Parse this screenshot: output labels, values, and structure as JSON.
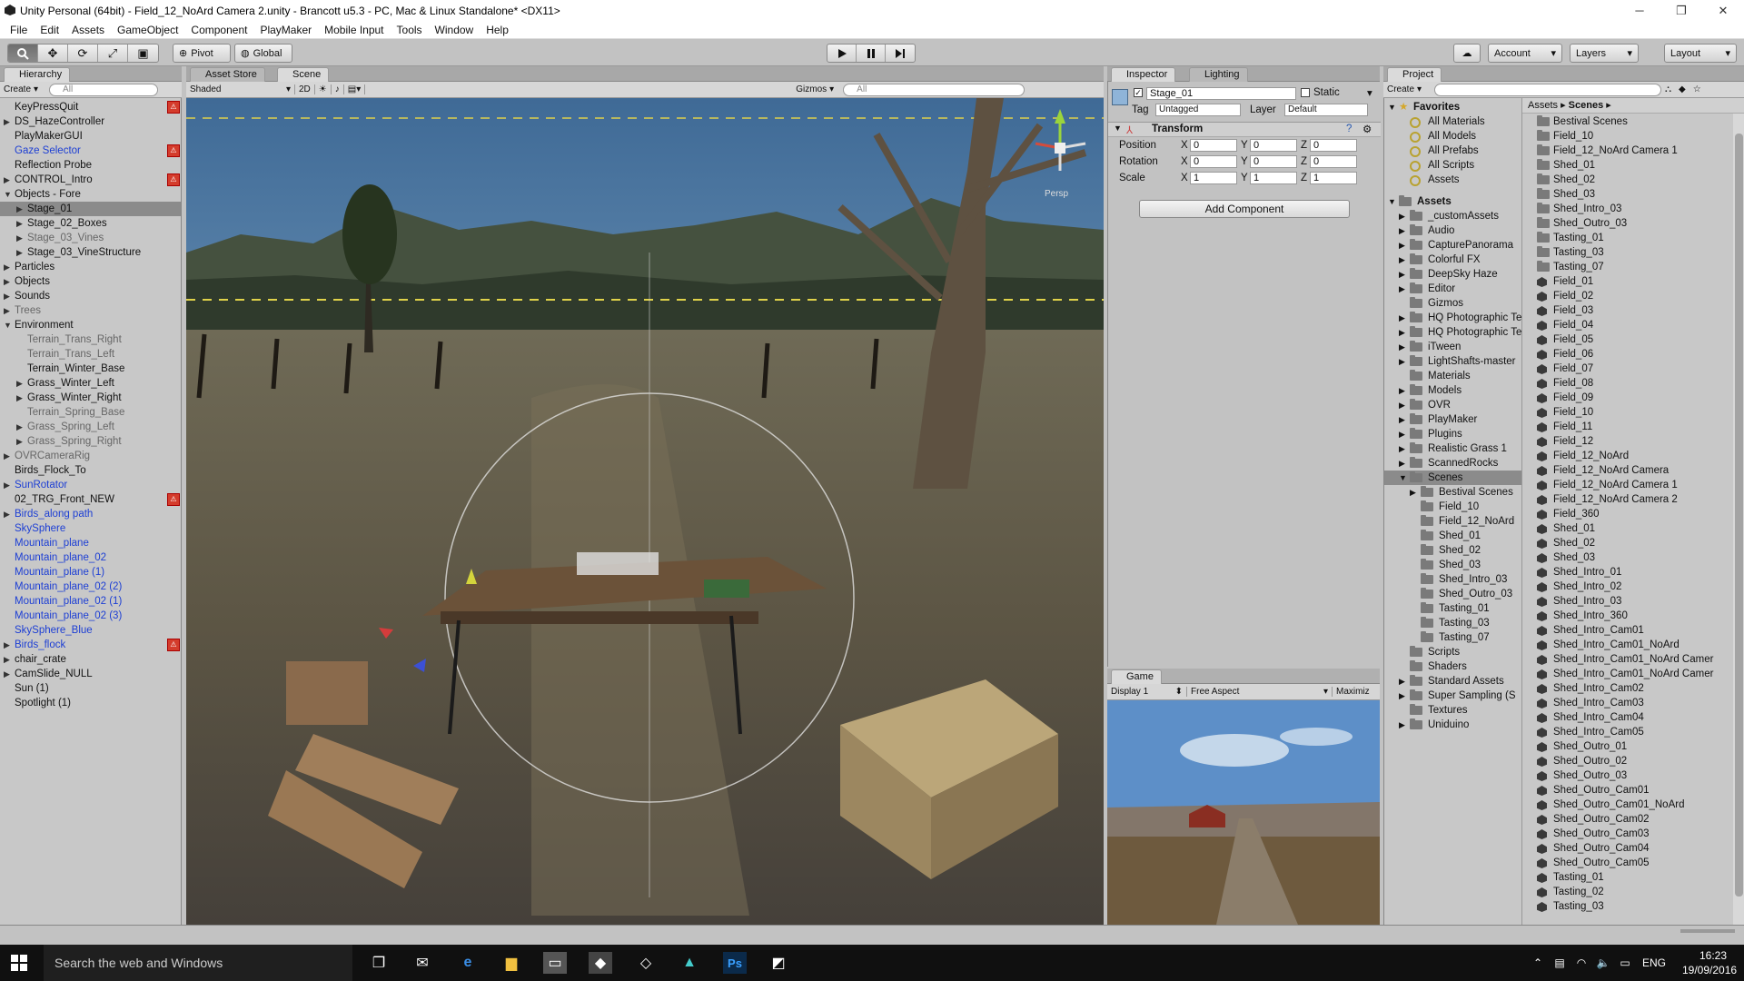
{
  "window": {
    "title": "Unity Personal (64bit) - Field_12_NoArd Camera 2.unity - Brancott u5.3 - PC, Mac & Linux Standalone* <DX11>",
    "controls": [
      "─",
      "❐",
      "✕"
    ]
  },
  "menus": [
    "File",
    "Edit",
    "Assets",
    "GameObject",
    "Component",
    "PlayMaker",
    "Mobile Input",
    "Tools",
    "Window",
    "Help"
  ],
  "toolbar": {
    "pivot": "Pivot",
    "global": "Global",
    "account": "Account",
    "layers": "Layers",
    "layout": "Layout"
  },
  "hierarchy": {
    "tab": "Hierarchy",
    "create": "Create",
    "search": "All",
    "items": [
      {
        "label": "KeyPressQuit",
        "indent": 0,
        "tri": "",
        "prefab": true,
        "color": "normal"
      },
      {
        "label": "DS_HazeController",
        "indent": 0,
        "tri": "▶",
        "prefab": false,
        "color": "normal"
      },
      {
        "label": "PlayMakerGUI",
        "indent": 0,
        "tri": "",
        "prefab": false,
        "color": "normal"
      },
      {
        "label": "Gaze Selector",
        "indent": 0,
        "tri": "",
        "prefab": true,
        "color": "blue"
      },
      {
        "label": "Reflection Probe",
        "indent": 0,
        "tri": "",
        "prefab": false,
        "color": "normal"
      },
      {
        "label": "CONTROL_Intro",
        "indent": 0,
        "tri": "▶",
        "prefab": true,
        "color": "normal"
      },
      {
        "label": "Objects - Fore",
        "indent": 0,
        "tri": "▼",
        "prefab": false,
        "color": "normal"
      },
      {
        "label": "Stage_01",
        "indent": 1,
        "tri": "▶",
        "prefab": false,
        "color": "sel"
      },
      {
        "label": "Stage_02_Boxes",
        "indent": 1,
        "tri": "▶",
        "prefab": false,
        "color": "normal"
      },
      {
        "label": "Stage_03_Vines",
        "indent": 1,
        "tri": "▶",
        "prefab": false,
        "color": "grey"
      },
      {
        "label": "Stage_03_VineStructure",
        "indent": 1,
        "tri": "▶",
        "prefab": false,
        "color": "normal"
      },
      {
        "label": "Particles",
        "indent": 0,
        "tri": "▶",
        "prefab": false,
        "color": "normal"
      },
      {
        "label": "Objects",
        "indent": 0,
        "tri": "▶",
        "prefab": false,
        "color": "normal"
      },
      {
        "label": "Sounds",
        "indent": 0,
        "tri": "▶",
        "prefab": false,
        "color": "normal"
      },
      {
        "label": "Trees",
        "indent": 0,
        "tri": "▶",
        "prefab": false,
        "color": "grey"
      },
      {
        "label": "Environment",
        "indent": 0,
        "tri": "▼",
        "prefab": false,
        "color": "normal"
      },
      {
        "label": "Terrain_Trans_Right",
        "indent": 1,
        "tri": "",
        "prefab": false,
        "color": "grey"
      },
      {
        "label": "Terrain_Trans_Left",
        "indent": 1,
        "tri": "",
        "prefab": false,
        "color": "grey"
      },
      {
        "label": "Terrain_Winter_Base",
        "indent": 1,
        "tri": "",
        "prefab": false,
        "color": "normal"
      },
      {
        "label": "Grass_Winter_Left",
        "indent": 1,
        "tri": "▶",
        "prefab": false,
        "color": "normal"
      },
      {
        "label": "Grass_Winter_Right",
        "indent": 1,
        "tri": "▶",
        "prefab": false,
        "color": "normal"
      },
      {
        "label": "Terrain_Spring_Base",
        "indent": 1,
        "tri": "",
        "prefab": false,
        "color": "grey"
      },
      {
        "label": "Grass_Spring_Left",
        "indent": 1,
        "tri": "▶",
        "prefab": false,
        "color": "grey"
      },
      {
        "label": "Grass_Spring_Right",
        "indent": 1,
        "tri": "▶",
        "prefab": false,
        "color": "grey"
      },
      {
        "label": "OVRCameraRig",
        "indent": 0,
        "tri": "▶",
        "prefab": false,
        "color": "grey"
      },
      {
        "label": "Birds_Flock_To",
        "indent": 0,
        "tri": "",
        "prefab": false,
        "color": "normal"
      },
      {
        "label": "SunRotator",
        "indent": 0,
        "tri": "▶",
        "prefab": false,
        "color": "blue"
      },
      {
        "label": "02_TRG_Front_NEW",
        "indent": 0,
        "tri": "",
        "prefab": true,
        "color": "normal"
      },
      {
        "label": "Birds_along path",
        "indent": 0,
        "tri": "▶",
        "prefab": false,
        "color": "blue"
      },
      {
        "label": "SkySphere",
        "indent": 0,
        "tri": "",
        "prefab": false,
        "color": "blue"
      },
      {
        "label": "Mountain_plane",
        "indent": 0,
        "tri": "",
        "prefab": false,
        "color": "blue"
      },
      {
        "label": "Mountain_plane_02",
        "indent": 0,
        "tri": "",
        "prefab": false,
        "color": "blue"
      },
      {
        "label": "Mountain_plane (1)",
        "indent": 0,
        "tri": "",
        "prefab": false,
        "color": "blue"
      },
      {
        "label": "Mountain_plane_02 (2)",
        "indent": 0,
        "tri": "",
        "prefab": false,
        "color": "blue"
      },
      {
        "label": "Mountain_plane_02 (1)",
        "indent": 0,
        "tri": "",
        "prefab": false,
        "color": "blue"
      },
      {
        "label": "Mountain_plane_02 (3)",
        "indent": 0,
        "tri": "",
        "prefab": false,
        "color": "blue"
      },
      {
        "label": "SkySphere_Blue",
        "indent": 0,
        "tri": "",
        "prefab": false,
        "color": "blue"
      },
      {
        "label": "Birds_flock",
        "indent": 0,
        "tri": "▶",
        "prefab": true,
        "color": "blue"
      },
      {
        "label": "chair_crate",
        "indent": 0,
        "tri": "▶",
        "prefab": false,
        "color": "normal"
      },
      {
        "label": "CamSlide_NULL",
        "indent": 0,
        "tri": "▶",
        "prefab": false,
        "color": "normal"
      },
      {
        "label": "Sun (1)",
        "indent": 0,
        "tri": "",
        "prefab": false,
        "color": "normal"
      },
      {
        "label": "Spotlight (1)",
        "indent": 0,
        "tri": "",
        "prefab": false,
        "color": "normal"
      }
    ]
  },
  "scene": {
    "tabs": [
      "Asset Store",
      "Scene"
    ],
    "shading": "Shaded",
    "mode2d": "2D",
    "gizmos": "Gizmos",
    "search": "All",
    "persp": "Persp"
  },
  "inspector": {
    "tabs": [
      "Inspector",
      "Lighting"
    ],
    "object_name": "Stage_01",
    "static_label": "Static",
    "tag_label": "Tag",
    "tag_value": "Untagged",
    "layer_label": "Layer",
    "layer_value": "Default",
    "component": "Transform",
    "rows": [
      {
        "label": "Position",
        "x": "0",
        "y": "0",
        "z": "0"
      },
      {
        "label": "Rotation",
        "x": "0",
        "y": "0",
        "z": "0"
      },
      {
        "label": "Scale",
        "x": "1",
        "y": "1",
        "z": "1"
      }
    ],
    "add_component": "Add Component"
  },
  "game": {
    "tab": "Game",
    "display": "Display 1",
    "aspect": "Free Aspect",
    "maximize": "Maximiz"
  },
  "project": {
    "tab": "Project",
    "create": "Create",
    "favorites_label": "Favorites",
    "favorites": [
      "All Materials",
      "All Models",
      "All Prefabs",
      "All Scripts",
      "Assets"
    ],
    "assets_label": "Assets",
    "folders": [
      {
        "label": "_customAssets",
        "indent": 1,
        "tri": "▶"
      },
      {
        "label": "Audio",
        "indent": 1,
        "tri": "▶"
      },
      {
        "label": "CapturePanorama",
        "indent": 1,
        "tri": "▶"
      },
      {
        "label": "Colorful FX",
        "indent": 1,
        "tri": "▶"
      },
      {
        "label": "DeepSky Haze",
        "indent": 1,
        "tri": "▶"
      },
      {
        "label": "Editor",
        "indent": 1,
        "tri": "▶"
      },
      {
        "label": "Gizmos",
        "indent": 1,
        "tri": ""
      },
      {
        "label": "HQ Photographic Te",
        "indent": 1,
        "tri": "▶"
      },
      {
        "label": "HQ Photographic Te",
        "indent": 1,
        "tri": "▶"
      },
      {
        "label": "iTween",
        "indent": 1,
        "tri": "▶"
      },
      {
        "label": "LightShafts-master",
        "indent": 1,
        "tri": "▶"
      },
      {
        "label": "Materials",
        "indent": 1,
        "tri": ""
      },
      {
        "label": "Models",
        "indent": 1,
        "tri": "▶"
      },
      {
        "label": "OVR",
        "indent": 1,
        "tri": "▶"
      },
      {
        "label": "PlayMaker",
        "indent": 1,
        "tri": "▶"
      },
      {
        "label": "Plugins",
        "indent": 1,
        "tri": "▶"
      },
      {
        "label": "Realistic Grass 1",
        "indent": 1,
        "tri": "▶"
      },
      {
        "label": "ScannedRocks",
        "indent": 1,
        "tri": "▶"
      },
      {
        "label": "Scenes",
        "indent": 1,
        "tri": "▼",
        "sel": true
      },
      {
        "label": "Bestival Scenes",
        "indent": 2,
        "tri": "▶"
      },
      {
        "label": "Field_10",
        "indent": 2,
        "tri": ""
      },
      {
        "label": "Field_12_NoArd",
        "indent": 2,
        "tri": ""
      },
      {
        "label": "Shed_01",
        "indent": 2,
        "tri": ""
      },
      {
        "label": "Shed_02",
        "indent": 2,
        "tri": ""
      },
      {
        "label": "Shed_03",
        "indent": 2,
        "tri": ""
      },
      {
        "label": "Shed_Intro_03",
        "indent": 2,
        "tri": ""
      },
      {
        "label": "Shed_Outro_03",
        "indent": 2,
        "tri": ""
      },
      {
        "label": "Tasting_01",
        "indent": 2,
        "tri": ""
      },
      {
        "label": "Tasting_03",
        "indent": 2,
        "tri": ""
      },
      {
        "label": "Tasting_07",
        "indent": 2,
        "tri": ""
      },
      {
        "label": "Scripts",
        "indent": 1,
        "tri": ""
      },
      {
        "label": "Shaders",
        "indent": 1,
        "tri": ""
      },
      {
        "label": "Standard Assets",
        "indent": 1,
        "tri": "▶"
      },
      {
        "label": "Super Sampling (S",
        "indent": 1,
        "tri": "▶"
      },
      {
        "label": "Textures",
        "indent": 1,
        "tri": ""
      },
      {
        "label": "Uniduino",
        "indent": 1,
        "tri": "▶"
      }
    ],
    "breadcrumb": [
      "Assets",
      "Scenes"
    ],
    "files": [
      {
        "label": "Bestival Scenes",
        "type": "folder"
      },
      {
        "label": "Field_10",
        "type": "folder"
      },
      {
        "label": "Field_12_NoArd Camera 1",
        "type": "folder"
      },
      {
        "label": "Shed_01",
        "type": "folder"
      },
      {
        "label": "Shed_02",
        "type": "folder"
      },
      {
        "label": "Shed_03",
        "type": "folder"
      },
      {
        "label": "Shed_Intro_03",
        "type": "folder"
      },
      {
        "label": "Shed_Outro_03",
        "type": "folder"
      },
      {
        "label": "Tasting_01",
        "type": "folder"
      },
      {
        "label": "Tasting_03",
        "type": "folder"
      },
      {
        "label": "Tasting_07",
        "type": "folder"
      },
      {
        "label": "Field_01",
        "type": "scene"
      },
      {
        "label": "Field_02",
        "type": "scene"
      },
      {
        "label": "Field_03",
        "type": "scene"
      },
      {
        "label": "Field_04",
        "type": "scene"
      },
      {
        "label": "Field_05",
        "type": "scene"
      },
      {
        "label": "Field_06",
        "type": "scene"
      },
      {
        "label": "Field_07",
        "type": "scene"
      },
      {
        "label": "Field_08",
        "type": "scene"
      },
      {
        "label": "Field_09",
        "type": "scene"
      },
      {
        "label": "Field_10",
        "type": "scene"
      },
      {
        "label": "Field_11",
        "type": "scene"
      },
      {
        "label": "Field_12",
        "type": "scene"
      },
      {
        "label": "Field_12_NoArd",
        "type": "scene"
      },
      {
        "label": "Field_12_NoArd Camera",
        "type": "scene"
      },
      {
        "label": "Field_12_NoArd Camera 1",
        "type": "scene"
      },
      {
        "label": "Field_12_NoArd Camera 2",
        "type": "scene"
      },
      {
        "label": "Field_360",
        "type": "scene"
      },
      {
        "label": "Shed_01",
        "type": "scene"
      },
      {
        "label": "Shed_02",
        "type": "scene"
      },
      {
        "label": "Shed_03",
        "type": "scene"
      },
      {
        "label": "Shed_Intro_01",
        "type": "scene"
      },
      {
        "label": "Shed_Intro_02",
        "type": "scene"
      },
      {
        "label": "Shed_Intro_03",
        "type": "scene"
      },
      {
        "label": "Shed_Intro_360",
        "type": "scene"
      },
      {
        "label": "Shed_Intro_Cam01",
        "type": "scene"
      },
      {
        "label": "Shed_Intro_Cam01_NoArd",
        "type": "scene"
      },
      {
        "label": "Shed_Intro_Cam01_NoArd Camer",
        "type": "scene"
      },
      {
        "label": "Shed_Intro_Cam01_NoArd Camer",
        "type": "scene"
      },
      {
        "label": "Shed_Intro_Cam02",
        "type": "scene"
      },
      {
        "label": "Shed_Intro_Cam03",
        "type": "scene"
      },
      {
        "label": "Shed_Intro_Cam04",
        "type": "scene"
      },
      {
        "label": "Shed_Intro_Cam05",
        "type": "scene"
      },
      {
        "label": "Shed_Outro_01",
        "type": "scene"
      },
      {
        "label": "Shed_Outro_02",
        "type": "scene"
      },
      {
        "label": "Shed_Outro_03",
        "type": "scene"
      },
      {
        "label": "Shed_Outro_Cam01",
        "type": "scene"
      },
      {
        "label": "Shed_Outro_Cam01_NoArd",
        "type": "scene"
      },
      {
        "label": "Shed_Outro_Cam02",
        "type": "scene"
      },
      {
        "label": "Shed_Outro_Cam03",
        "type": "scene"
      },
      {
        "label": "Shed_Outro_Cam04",
        "type": "scene"
      },
      {
        "label": "Shed_Outro_Cam05",
        "type": "scene"
      },
      {
        "label": "Tasting_01",
        "type": "scene"
      },
      {
        "label": "Tasting_02",
        "type": "scene"
      },
      {
        "label": "Tasting_03",
        "type": "scene"
      }
    ]
  },
  "taskbar": {
    "search": "Search the web and Windows",
    "lang": "ENG",
    "time": "16:23",
    "date": "19/09/2016"
  },
  "colors": {
    "prefab_badge": "#d43c2c",
    "blue_text": "#1c3ed4",
    "selection": "#8b8b8b"
  }
}
